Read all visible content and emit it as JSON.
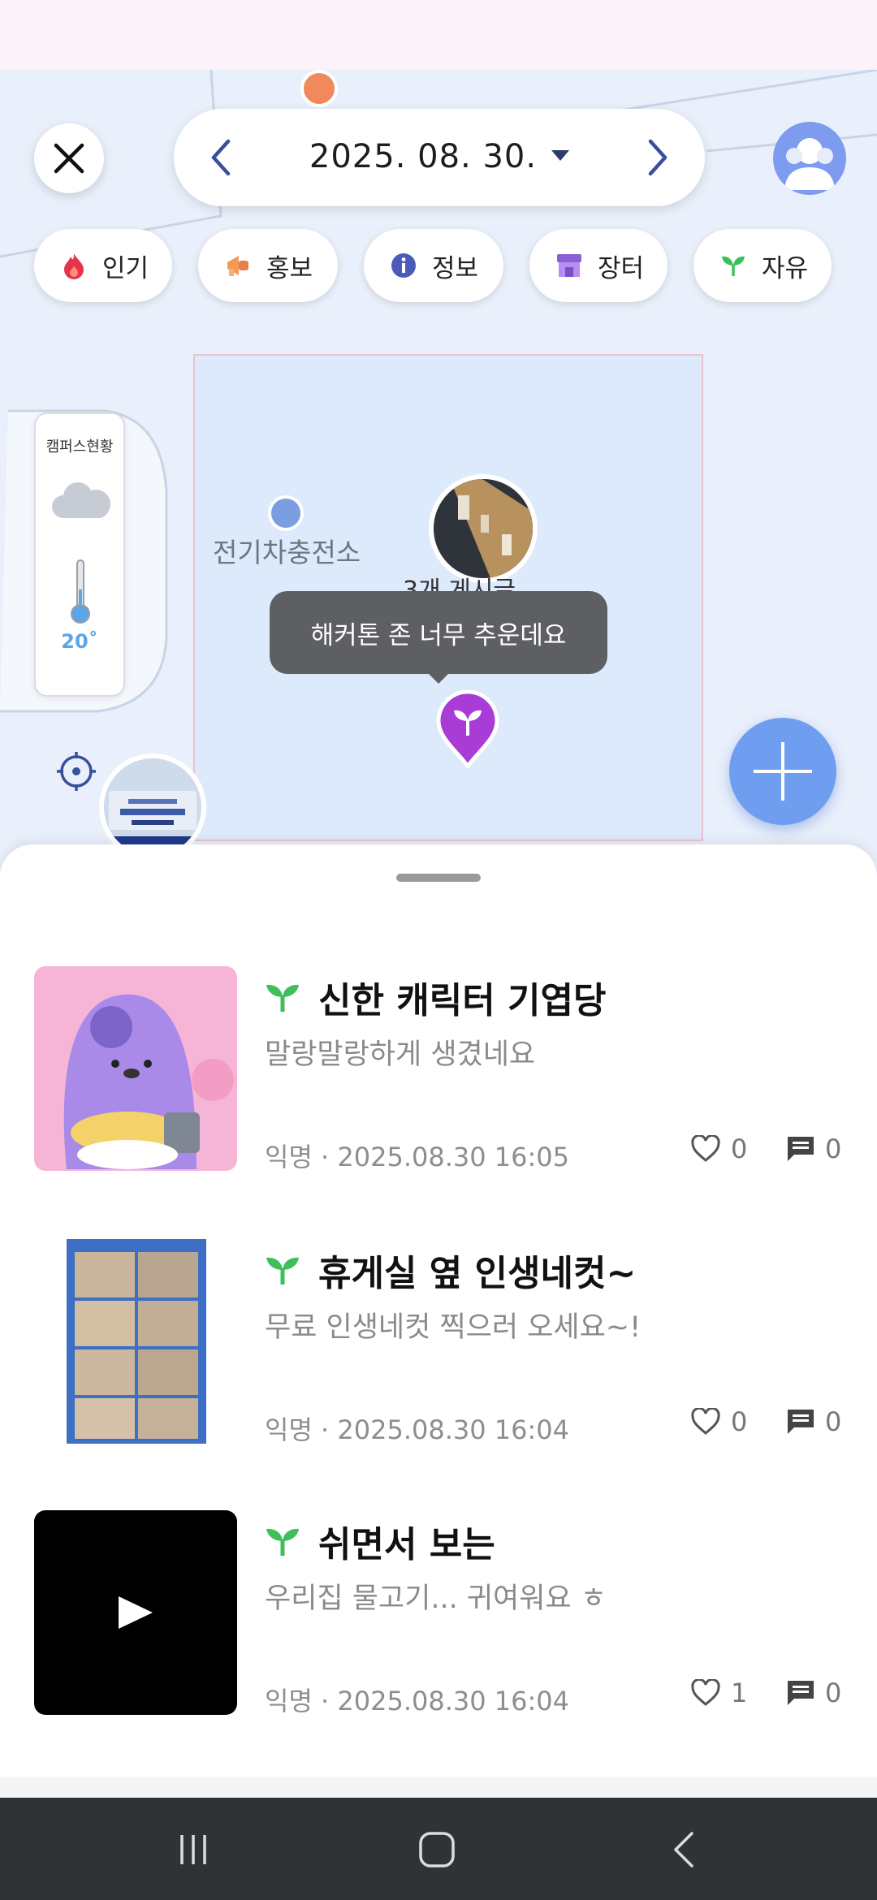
{
  "header": {
    "date": "2025. 08. 30."
  },
  "filters": [
    {
      "label": "인기",
      "icon": "fire-icon"
    },
    {
      "label": "홍보",
      "icon": "megaphone-icon"
    },
    {
      "label": "정보",
      "icon": "info-icon"
    },
    {
      "label": "장터",
      "icon": "store-icon"
    },
    {
      "label": "자유",
      "icon": "sprout-icon"
    }
  ],
  "map": {
    "road_label": "전기차충전소",
    "campus_status": {
      "title": "캠퍼스현황",
      "temperature": "20˚",
      "weather_icon": "cloud-icon"
    },
    "cluster_count": "3개 게시글",
    "bubble_text": "해커톤 존 너무 추운데요"
  },
  "posts": [
    {
      "title": "신한 캐릭터 기엽당",
      "body": "말랑말랑하게 생겼네요",
      "meta": "익명 · 2025.08.30 16:05",
      "likes": "0",
      "comments": "0"
    },
    {
      "title": "휴게실 옆 인생네컷~",
      "body": "무료 인생네컷 찍으러 오세요~!",
      "meta": "익명 · 2025.08.30 16:04",
      "likes": "0",
      "comments": "0"
    },
    {
      "title": "쉬면서 보는",
      "body": "우리집 물고기... 귀여워요 ㅎ",
      "meta": "익명 · 2025.08.30 16:04",
      "likes": "1",
      "comments": "0"
    }
  ],
  "colors": {
    "accent_blue": "#6f9ef0",
    "sprout_green": "#3fbf5a",
    "pin_purple": "#a93bd6"
  }
}
